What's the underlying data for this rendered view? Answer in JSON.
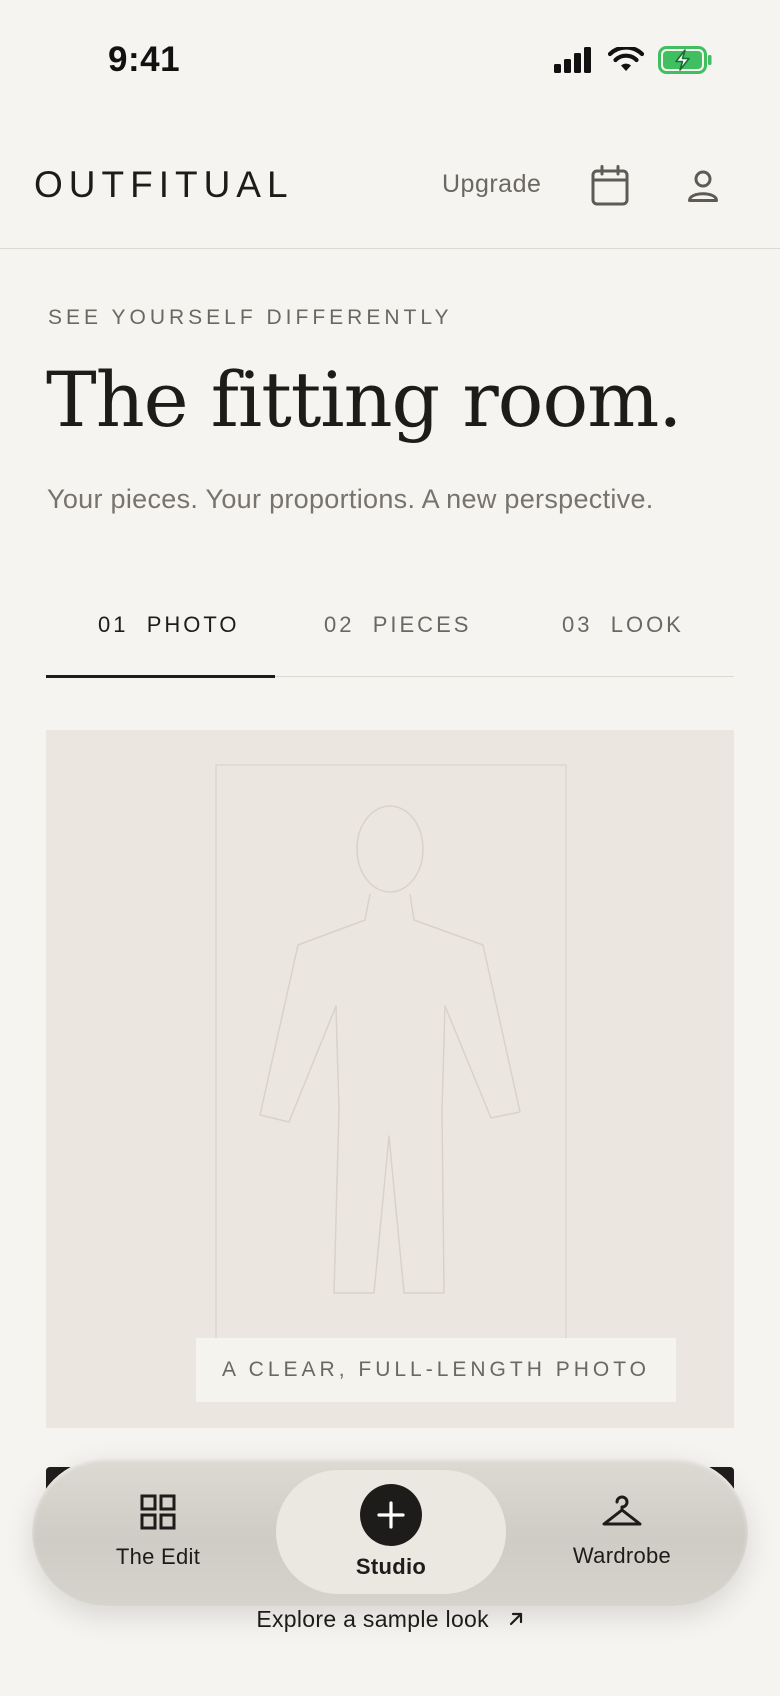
{
  "status_bar": {
    "time": "9:41"
  },
  "header": {
    "brand": "OUTFITUAL",
    "upgrade_label": "Upgrade"
  },
  "hero": {
    "eyebrow": "SEE YOURSELF DIFFERENTLY",
    "title": "The fitting room.",
    "subtitle": "Your pieces. Your proportions. A new perspective."
  },
  "steps": [
    {
      "number": "01",
      "label": "PHOTO",
      "active": true
    },
    {
      "number": "02",
      "label": "PIECES",
      "active": false
    },
    {
      "number": "03",
      "label": "LOOK",
      "active": false
    }
  ],
  "photo": {
    "caption": "A CLEAR, FULL-LENGTH PHOTO"
  },
  "nav": {
    "items": [
      {
        "label": "The Edit",
        "icon": "grid-icon"
      },
      {
        "label": "Studio",
        "icon": "plus-icon",
        "active": true
      },
      {
        "label": "Wardrobe",
        "icon": "hanger-icon"
      }
    ]
  },
  "explore_label": "Explore a sample look",
  "colors": {
    "background": "#f6f4f0",
    "ink": "#1d1c1a",
    "muted": "#6b6863",
    "photo_bg": "#ebe7e0",
    "battery": "#3fbf5f"
  }
}
